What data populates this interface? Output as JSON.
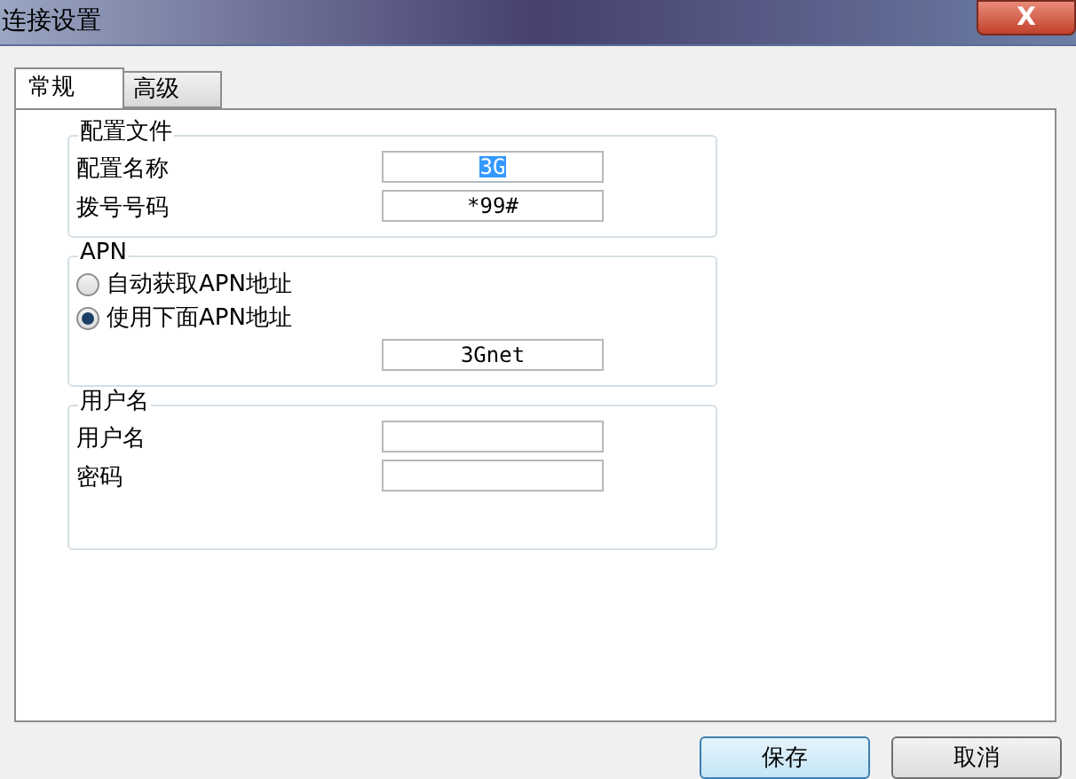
{
  "window": {
    "title": "连接设置",
    "close": "X"
  },
  "tabs": [
    {
      "label": "常规",
      "selected": true
    },
    {
      "label": "高级",
      "selected": false
    }
  ],
  "groups": [
    {
      "title": "配置文件",
      "rows": [
        {
          "kind": "field",
          "label": "配置名称",
          "value": "3G",
          "highlighted": true
        },
        {
          "kind": "field",
          "label": "拨号号码",
          "value": "*99#",
          "highlighted": false
        }
      ]
    },
    {
      "title": "APN",
      "rows": [
        {
          "kind": "radio",
          "label": "自动获取APN地址",
          "selected": false
        },
        {
          "kind": "radio",
          "label": "使用下面APN地址",
          "selected": true
        },
        {
          "kind": "field",
          "value": "3Gnet",
          "highlighted": false
        }
      ]
    },
    {
      "title": "用户名",
      "rows": [
        {
          "kind": "field",
          "label": "用户名"
        },
        {
          "kind": "field",
          "label": "密码"
        }
      ]
    }
  ],
  "buttons": [
    {
      "label": "保存",
      "default": true
    },
    {
      "label": "取消",
      "default": false
    }
  ]
}
